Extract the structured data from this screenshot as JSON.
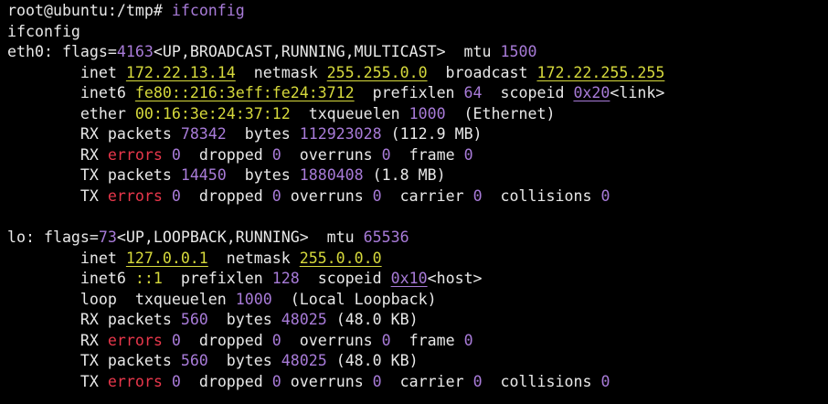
{
  "colors": {
    "background": "#000000",
    "text": "#e8e8e8",
    "number": "#a87bd8",
    "address": "#d6d93c",
    "error": "#e8374b"
  },
  "terminal": {
    "prompt": "root@ubuntu:/tmp#",
    "command": "ifconfig",
    "echo": "ifconfig",
    "eth0": {
      "name": "eth0",
      "flags_value": "4163",
      "flags_list": "<UP,BROADCAST,RUNNING,MULTICAST>",
      "mtu": "1500",
      "inet": "172.22.13.14",
      "netmask": "255.255.0.0",
      "broadcast": "172.22.255.255",
      "inet6": "fe80::216:3eff:fe24:3712",
      "prefixlen": "64",
      "scopeid": "0x20",
      "scope": "<link>",
      "ether": "00:16:3e:24:37:12",
      "txqueuelen": "1000",
      "link_type": "(Ethernet)",
      "rx_packets": "78342",
      "rx_bytes": "112923028",
      "rx_human": "(112.9 MB)",
      "rx_errors": "0",
      "rx_dropped": "0",
      "rx_overruns": "0",
      "rx_frame": "0",
      "tx_packets": "14450",
      "tx_bytes": "1880408",
      "tx_human": "(1.8 MB)",
      "tx_errors": "0",
      "tx_dropped": "0",
      "tx_overruns": "0",
      "tx_carrier": "0",
      "tx_collisions": "0"
    },
    "lo": {
      "name": "lo",
      "flags_value": "73",
      "flags_list": "<UP,LOOPBACK,RUNNING>",
      "mtu": "65536",
      "inet": "127.0.0.1",
      "netmask": "255.0.0.0",
      "inet6": "::1",
      "prefixlen": "128",
      "scopeid": "0x10",
      "scope": "<host>",
      "txqueuelen": "1000",
      "link_type": "(Local Loopback)",
      "rx_packets": "560",
      "rx_bytes": "48025",
      "rx_human": "(48.0 KB)",
      "rx_errors": "0",
      "rx_dropped": "0",
      "rx_overruns": "0",
      "rx_frame": "0",
      "tx_packets": "560",
      "tx_bytes": "48025",
      "tx_human": "(48.0 KB)",
      "tx_errors": "0",
      "tx_dropped": "0",
      "tx_overruns": "0",
      "tx_carrier": "0",
      "tx_collisions": "0"
    }
  }
}
